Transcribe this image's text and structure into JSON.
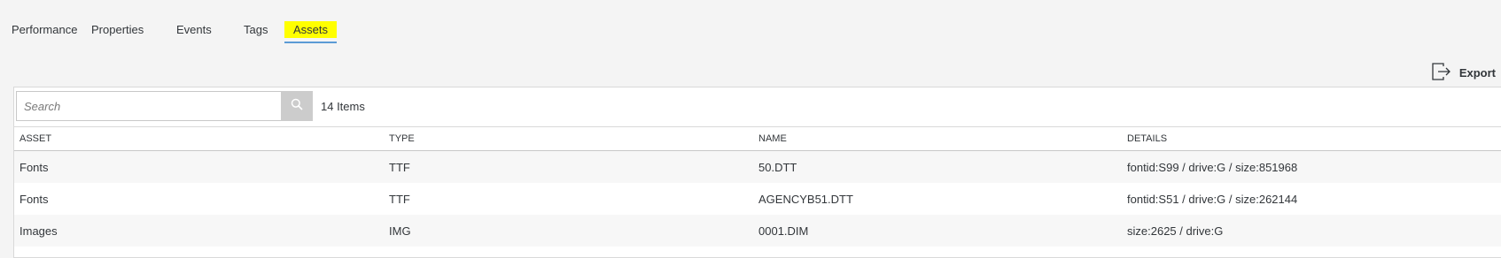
{
  "tabs": [
    {
      "label": "Performance",
      "active": false
    },
    {
      "label": "Properties",
      "active": false
    },
    {
      "label": "Events",
      "active": false
    },
    {
      "label": "Tags",
      "active": false
    },
    {
      "label": "Assets",
      "active": true
    }
  ],
  "toolbar": {
    "export_label": "Export",
    "export_icon": "export-icon",
    "search_placeholder": "Search",
    "search_value": "",
    "search_icon": "search-icon",
    "item_count": "14 Items"
  },
  "table": {
    "columns": [
      "ASSET",
      "TYPE",
      "NAME",
      "DETAILS"
    ],
    "rows": [
      [
        "Fonts",
        "TTF",
        "50.DTT",
        "fontid:S99 / drive:G / size:851968"
      ],
      [
        "Fonts",
        "TTF",
        "AGENCYB51.DTT",
        "fontid:S51 / drive:G / size:262144"
      ],
      [
        "Images",
        "IMG",
        "0001.DIM",
        "size:2625 / drive:G"
      ]
    ]
  },
  "colors": {
    "active_tab_highlight": "#ffff00",
    "active_tab_underline": "#5b9bd5",
    "search_button_bg": "#cccccc",
    "page_bg": "#f4f4f4"
  }
}
